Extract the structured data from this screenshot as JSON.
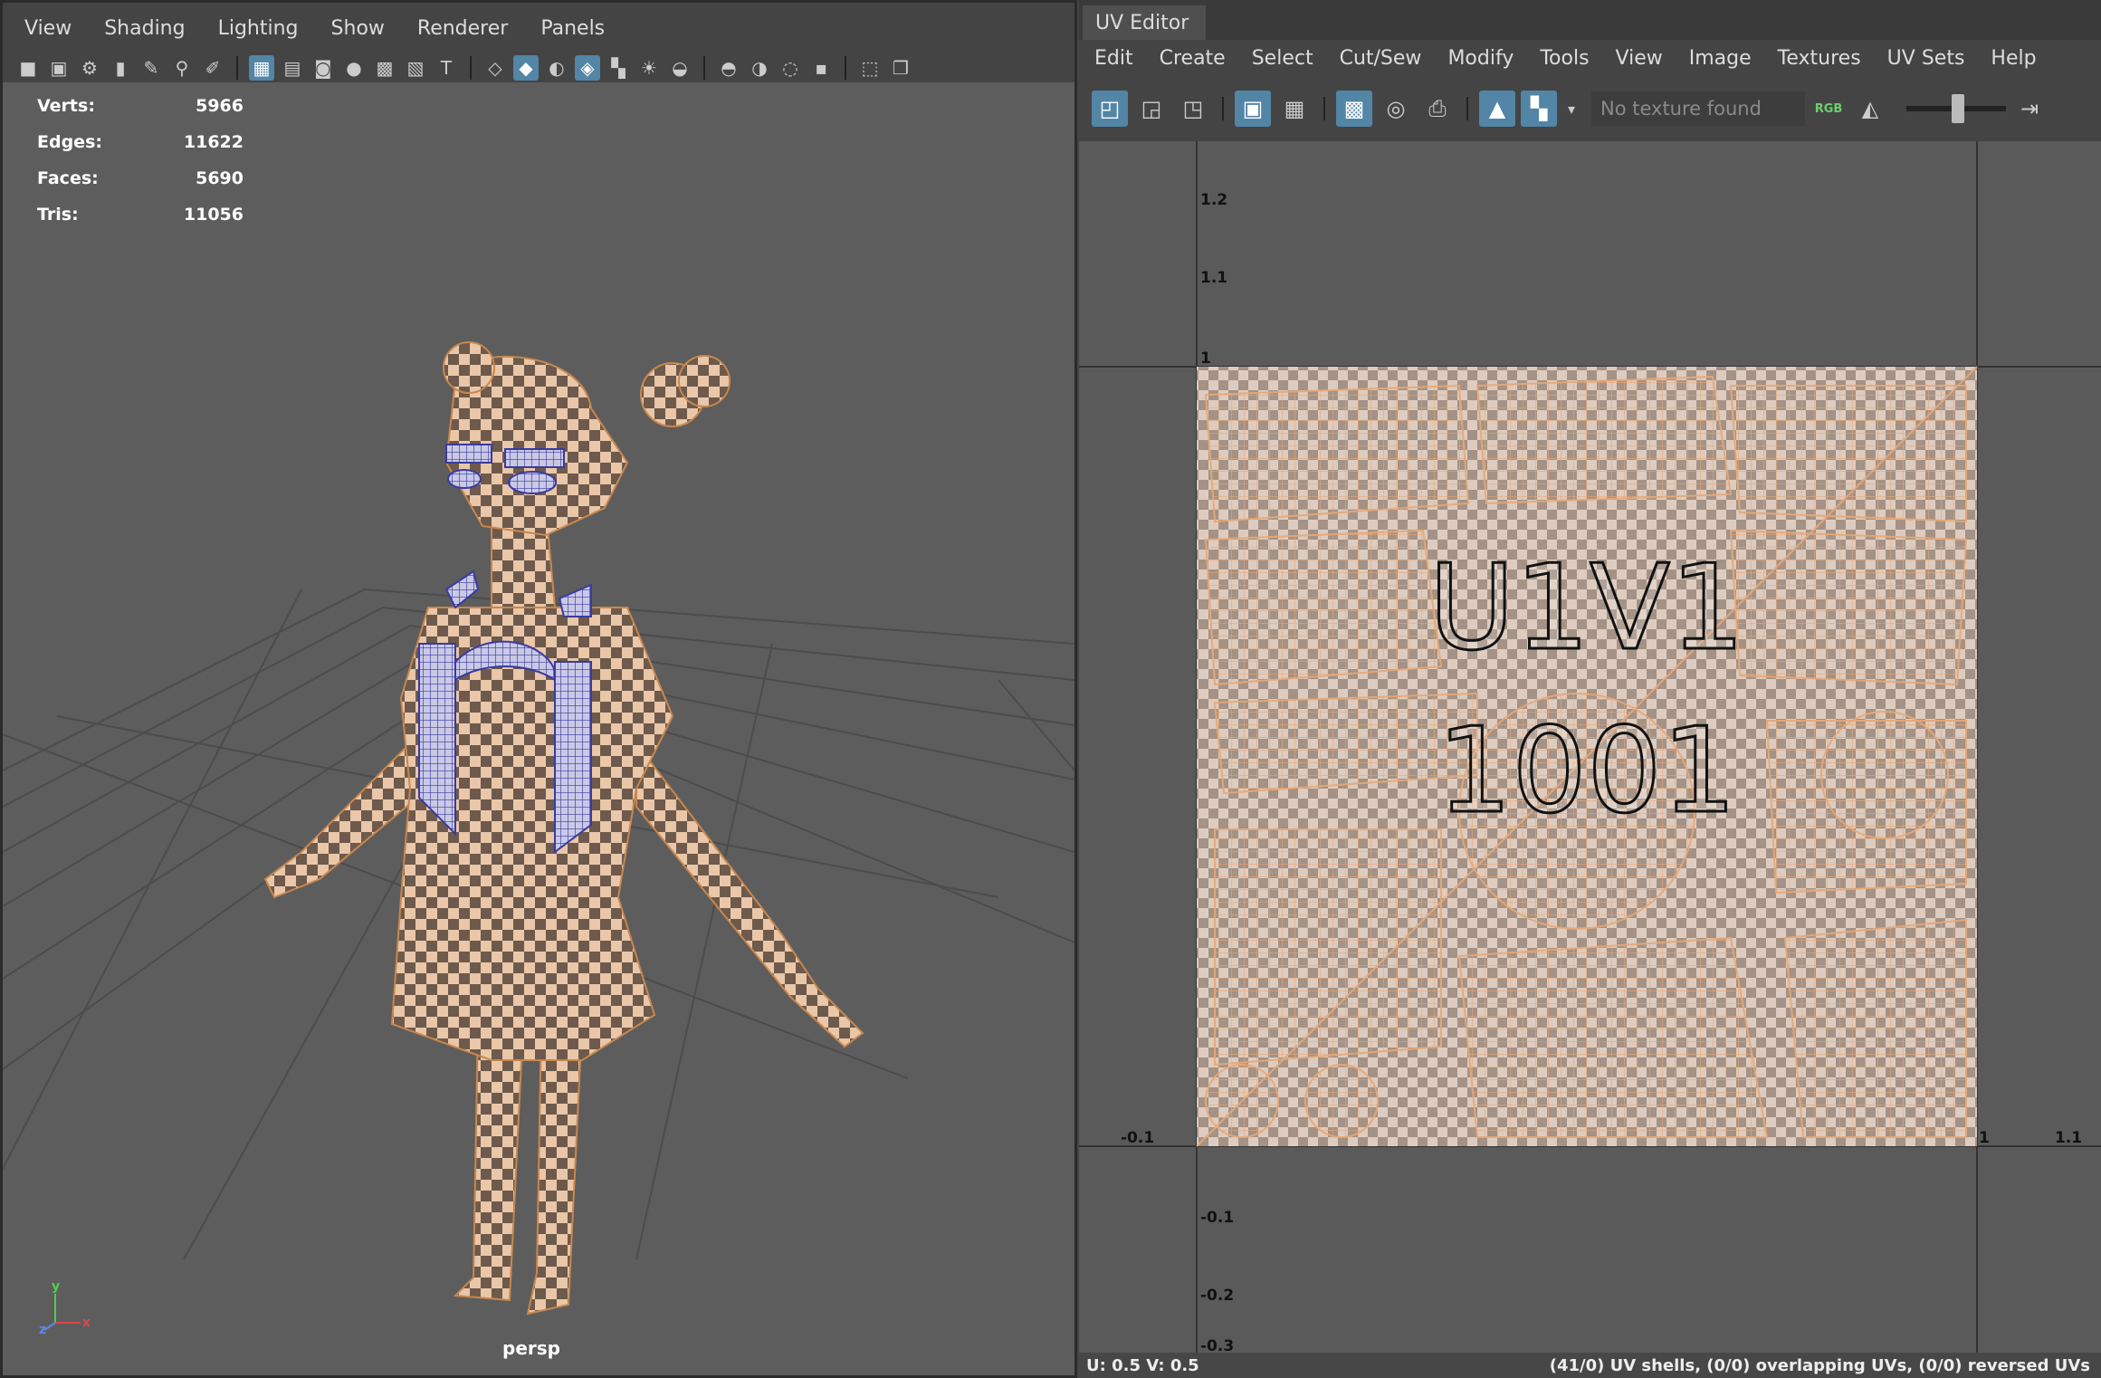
{
  "viewport_panel": {
    "menu": [
      "View",
      "Shading",
      "Lighting",
      "Show",
      "Renderer",
      "Panels"
    ],
    "stats": [
      {
        "label": "Verts:",
        "value": "5966"
      },
      {
        "label": "Edges:",
        "value": "11622"
      },
      {
        "label": "Faces:",
        "value": "5690"
      },
      {
        "label": "Tris:",
        "value": "11056"
      }
    ],
    "camera_label": "persp",
    "axis": {
      "y": "y",
      "x": "x",
      "z": "z"
    }
  },
  "uv_editor": {
    "tab_title": "UV Editor",
    "menu": [
      "Edit",
      "Create",
      "Select",
      "Cut/Sew",
      "Modify",
      "Tools",
      "View",
      "Image",
      "Textures",
      "UV Sets",
      "Help"
    ],
    "texture_placeholder": "No texture found",
    "rgb_label": "RGB",
    "tile_label_1": "U1V1",
    "tile_label_2": "1001",
    "v_axis_labels": [
      "1.2",
      "1.1",
      "1",
      "-0.1",
      "-0.2",
      "-0.3"
    ],
    "u_axis_labels": [
      "-0.1",
      "1",
      "1.1"
    ],
    "status_uv": "U:  0.5 V:  0.5",
    "status_shells": "(41/0) UV shells, (0/0) overlapping UVs, (0/0) reversed UVs"
  },
  "colors": {
    "accent": "#5285a6",
    "uv_shell": "#e8a878",
    "wire_blue": "#3a3aa0",
    "background": "#5d5d5d"
  },
  "icons": [
    "camera-icon",
    "grid-icon",
    "wireframe-icon",
    "shaded-icon",
    "light-icon",
    "snapshot-icon"
  ]
}
